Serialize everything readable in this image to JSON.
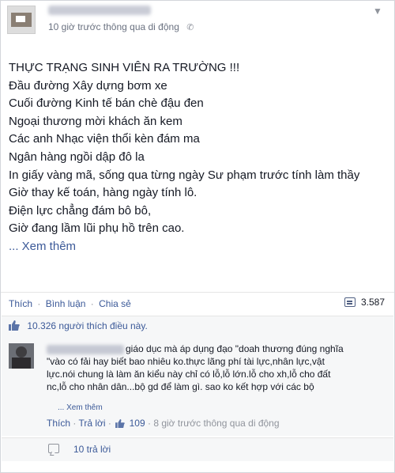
{
  "post": {
    "timestamp": "10 giờ trước thông qua di động",
    "mobile_icon": "mobile-icon",
    "menu_icon": "chevron-down-icon",
    "lines": [
      "THỰC TRẠNG SINH VIÊN RA TRƯỜNG !!!",
      "Đầu đường Xây dựng bơm xe",
      "Cuối đường Kinh tế bán chè đậu đen",
      "Ngoại thương mời khách ăn kem",
      "Các anh Nhạc viện thổi kèn đám ma",
      "Ngân hàng ngồi dập đô la",
      "In giấy vàng mã, sống qua từng ngày Sư phạm trước tính làm thầy",
      "Giờ thay kế toán, hàng ngày tính lô.",
      "Điện lực chẳng đám bô bô,",
      "Giờ đang lầm lũi phụ hồ trên cao."
    ],
    "see_more": "... Xem thêm"
  },
  "actions": {
    "like": "Thích",
    "comment": "Bình luận",
    "share": "Chia sẻ",
    "separator": "·",
    "share_count": "3.587"
  },
  "likes": {
    "count": "10.326",
    "text": "người thích điều này."
  },
  "comment": {
    "lines": [
      "giáo dục mà áp dụng đạo \"doah thương đúng nghĩa",
      "\"vào có fải hay biết bao nhiêu ko.thực lãng phí tài lực,nhân lực,vật",
      "lực.nói chung là làm ăn kiểu này chỉ có lỗ,lỗ lớn.lỗ cho xh,lỗ cho đất",
      "nc,lỗ cho nhân dân...bộ gd để làm gì. sao ko kết hợp với các bộ"
    ],
    "see_more": "... Xem thêm",
    "like": "Thích",
    "reply": "Trả lời",
    "like_count": "109",
    "timestamp": "8 giờ trước thông qua di động",
    "separator": "·"
  },
  "replies": {
    "label": "10 trả lời"
  },
  "colors": {
    "link": "#3b5998",
    "muted": "#90949c",
    "bar_bg": "#f6f7f8"
  }
}
